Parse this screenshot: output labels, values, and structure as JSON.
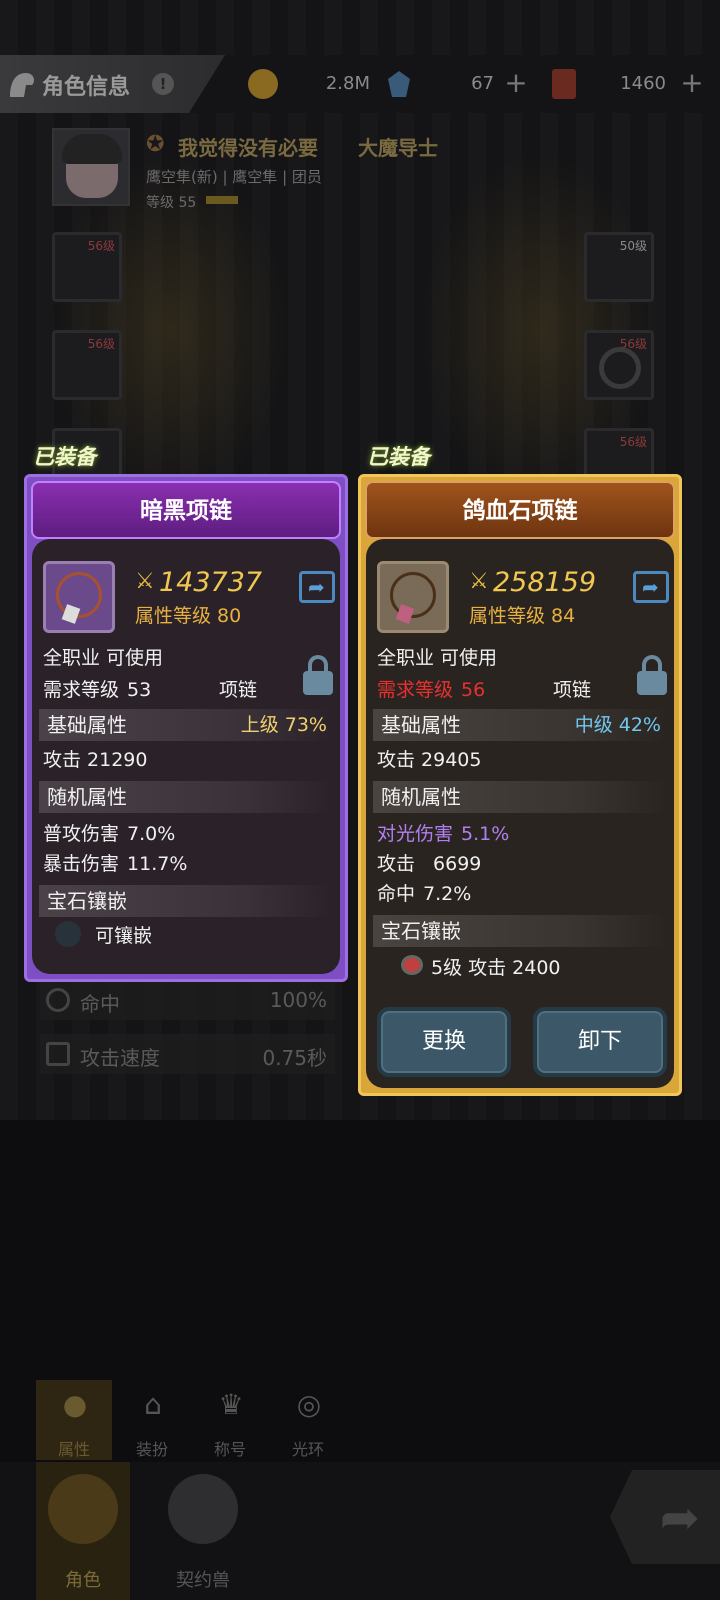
{
  "header": {
    "title": "角色信息",
    "help": "!",
    "gold": "2.8M",
    "crystal": "67",
    "ticket": "1460",
    "plus": "+"
  },
  "player": {
    "name": "我觉得没有必要",
    "class": "大魔导士",
    "guild_line": "鹰空隼(新) | 鹰空隼 | 团员",
    "level": "等级 55"
  },
  "slots": {
    "top_left_lv": "56级",
    "mid_left_lv": "56级",
    "top_right_lv": "50级",
    "mid_right_lv": "56级",
    "low_right_lv": "56级"
  },
  "stats": [
    {
      "label": "命中",
      "value": "100%"
    },
    {
      "label": "攻击速度",
      "value": "0.75秒"
    }
  ],
  "left_card": {
    "equipped": "已装备",
    "name": "暗黑项链",
    "power": "143737",
    "attr_level": "属性等级 80",
    "job": "全职业 可使用",
    "req_label": "需求等级",
    "req_value": "53",
    "type": "项链",
    "base_title": "基础属性",
    "base_grade": "上级  73%",
    "base_attack": "攻击  21290",
    "random_title": "随机属性",
    "random": [
      {
        "label": "普攻伤害",
        "value": "7.0%"
      },
      {
        "label": "暴击伤害",
        "value": "11.7%"
      }
    ],
    "gem_title": "宝石镶嵌",
    "gem_text": "可镶嵌"
  },
  "right_card": {
    "equipped": "已装备",
    "name": "鸽血石项链",
    "power": "258159",
    "attr_level": "属性等级 84",
    "job": "全职业 可使用",
    "req_label": "需求等级",
    "req_value": "56",
    "type": "项链",
    "base_title": "基础属性",
    "base_grade": "中级  42%",
    "base_attack": "攻击  29405",
    "random_title": "随机属性",
    "random": [
      {
        "label": "对光伤害",
        "value": "5.1%"
      },
      {
        "label": "攻击",
        "value": "6699"
      },
      {
        "label": "命中",
        "value": "7.2%"
      }
    ],
    "gem_title": "宝石镶嵌",
    "gem_text": "5级  攻击 2400",
    "btn_replace": "更换",
    "btn_remove": "卸下"
  },
  "subtabs": [
    "属性",
    "装扮",
    "称号",
    "光环"
  ],
  "nav": [
    "角色",
    "契约兽"
  ],
  "colors": {
    "purple_frame": "#7d4fc2",
    "gold_frame": "#d9a63a",
    "power_text": "#f0c850",
    "req_red": "#e83030",
    "grade_mid": "#70c8f0"
  }
}
